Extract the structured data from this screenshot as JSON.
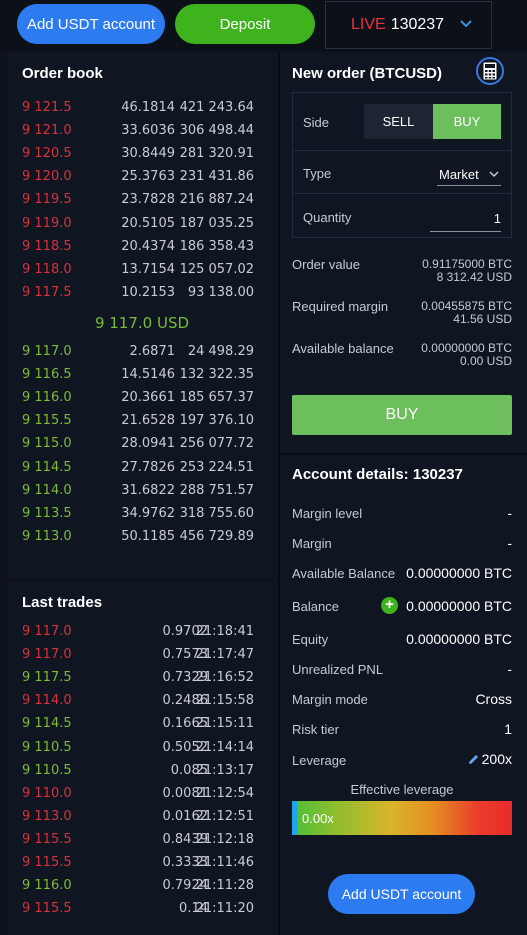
{
  "header": {
    "add_usdt_label": "Add USDT account",
    "deposit_label": "Deposit",
    "live_label": "LIVE",
    "account_number": "130237"
  },
  "order_book": {
    "title": "Order book",
    "asks": [
      {
        "price": "9 121.5",
        "size": "46.1814",
        "total": "421 243.64"
      },
      {
        "price": "9 121.0",
        "size": "33.6036",
        "total": "306 498.44"
      },
      {
        "price": "9 120.5",
        "size": "30.8449",
        "total": "281 320.91"
      },
      {
        "price": "9 120.0",
        "size": "25.3763",
        "total": "231 431.86"
      },
      {
        "price": "9 119.5",
        "size": "23.7828",
        "total": "216 887.24"
      },
      {
        "price": "9 119.0",
        "size": "20.5105",
        "total": "187 035.25"
      },
      {
        "price": "9 118.5",
        "size": "20.4374",
        "total": "186 358.43"
      },
      {
        "price": "9 118.0",
        "size": "13.7154",
        "total": "125 057.02"
      },
      {
        "price": "9 117.5",
        "size": "10.2153",
        "total": "93 138.00"
      }
    ],
    "mid_price": "9 117.0 USD",
    "bids": [
      {
        "price": "9 117.0",
        "size": "2.6871",
        "total": "24 498.29"
      },
      {
        "price": "9 116.5",
        "size": "14.5146",
        "total": "132 322.35"
      },
      {
        "price": "9 116.0",
        "size": "20.3661",
        "total": "185 657.37"
      },
      {
        "price": "9 115.5",
        "size": "21.6528",
        "total": "197 376.10"
      },
      {
        "price": "9 115.0",
        "size": "28.0941",
        "total": "256 077.72"
      },
      {
        "price": "9 114.5",
        "size": "27.7826",
        "total": "253 224.51"
      },
      {
        "price": "9 114.0",
        "size": "31.6822",
        "total": "288 751.57"
      },
      {
        "price": "9 113.5",
        "size": "34.9762",
        "total": "318 755.60"
      },
      {
        "price": "9 113.0",
        "size": "50.1185",
        "total": "456 729.89"
      }
    ]
  },
  "last_trades": {
    "title": "Last trades",
    "rows": [
      {
        "price": "9 117.0",
        "amount": "0.9702",
        "time": "21:18:41",
        "side": "sell"
      },
      {
        "price": "9 117.0",
        "amount": "0.7573",
        "time": "21:17:47",
        "side": "sell"
      },
      {
        "price": "9 117.5",
        "amount": "0.7329",
        "time": "21:16:52",
        "side": "buy"
      },
      {
        "price": "9 114.0",
        "amount": "0.2486",
        "time": "21:15:58",
        "side": "sell"
      },
      {
        "price": "9 114.5",
        "amount": "0.1665",
        "time": "21:15:11",
        "side": "buy"
      },
      {
        "price": "9 110.5",
        "amount": "0.5052",
        "time": "21:14:14",
        "side": "buy"
      },
      {
        "price": "9 110.5",
        "amount": "0.085",
        "time": "21:13:17",
        "side": "buy"
      },
      {
        "price": "9 110.0",
        "amount": "0.0081",
        "time": "21:12:54",
        "side": "sell"
      },
      {
        "price": "9 113.0",
        "amount": "0.0162",
        "time": "21:12:51",
        "side": "sell"
      },
      {
        "price": "9 115.5",
        "amount": "0.8439",
        "time": "21:12:18",
        "side": "sell"
      },
      {
        "price": "9 115.5",
        "amount": "0.3333",
        "time": "21:11:46",
        "side": "sell"
      },
      {
        "price": "9 116.0",
        "amount": "0.7924",
        "time": "21:11:28",
        "side": "buy"
      },
      {
        "price": "9 115.5",
        "amount": "0.14",
        "time": "21:11:20",
        "side": "sell"
      }
    ]
  },
  "new_order": {
    "title": "New order (BTCUSD)",
    "side_label": "Side",
    "sell_label": "SELL",
    "buy_label": "BUY",
    "type_label": "Type",
    "type_value": "Market",
    "quantity_label": "Quantity",
    "quantity_value": "1",
    "order_value_label": "Order value",
    "order_value_btc": "0.91175000 BTC",
    "order_value_usd": "8 312.42 USD",
    "required_margin_label": "Required margin",
    "required_margin_btc": "0.00455875 BTC",
    "required_margin_usd": "41.56 USD",
    "available_balance_label": "Available balance",
    "available_balance_btc": "0.00000000 BTC",
    "available_balance_usd": "0.00 USD",
    "buy_button_label": "BUY"
  },
  "account_details": {
    "title": "Account details: 130237",
    "margin_level_label": "Margin level",
    "margin_level_value": "-",
    "margin_label": "Margin",
    "margin_value": "-",
    "available_balance_label": "Available Balance",
    "available_balance_value": "0.00000000 BTC",
    "balance_label": "Balance",
    "balance_value": "0.00000000 BTC",
    "equity_label": "Equity",
    "equity_value": "0.00000000 BTC",
    "unrealized_pnl_label": "Unrealized PNL",
    "unrealized_pnl_value": "-",
    "margin_mode_label": "Margin mode",
    "margin_mode_value": "Cross",
    "risk_tier_label": "Risk tier",
    "risk_tier_value": "1",
    "leverage_label": "Leverage",
    "leverage_value": "200x",
    "effective_leverage_label": "Effective leverage",
    "effective_leverage_value": "0.00x",
    "add_usdt_label": "Add USDT account"
  },
  "colors": {
    "ask": "#d8323c",
    "bid": "#7dbb39",
    "accent_blue": "#2d7bf0",
    "accent_green": "#3eb31e",
    "buy_green": "#6cbf5c"
  }
}
